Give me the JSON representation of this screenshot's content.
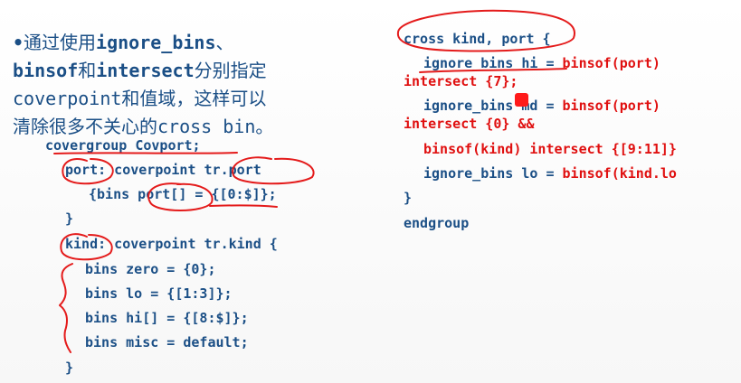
{
  "bullet": {
    "bullet_char": "•",
    "seg1": "通过使用",
    "seg2": "ignore_bins",
    "seg3": "、",
    "seg4": "binsof",
    "seg5": "和",
    "seg6": "intersect",
    "seg7": "分别指定",
    "seg8": "coverpoint",
    "seg9": "和值域，这样可以",
    "seg10": "清除很多不关心的",
    "seg11": "cross bin",
    "seg12": "。"
  },
  "left_code": {
    "l1": "covergroup Covport;",
    "l2": "port: coverpoint tr.port",
    "l3": "{bins port[] = {[0:$]};",
    "l4": "}",
    "l5": "kind: coverpoint tr.kind {",
    "l6": "bins zero = {0};",
    "l7": "bins lo = {[1:3]};",
    "l8": "bins hi[] = {[8:$]};",
    "l9": "bins misc = default;",
    "l10": "}"
  },
  "right_code": {
    "r1": "cross kind, port {",
    "r2a": "ignore_bins hi = ",
    "r2b": "binsof(port)",
    "r3": "intersect {7};",
    "r4a": "ignore_bins md = ",
    "r4b": "binsof(port)",
    "r5": "intersect {0} &&",
    "r6": "binsof(kind) intersect {[9:11]}",
    "r7a": "ignore_bins lo = ",
    "r7b": "binsof(kind.lo",
    "r8": "}",
    "r9": "endgroup"
  },
  "colors": {
    "text_blue": "#1b4f86",
    "text_red": "#e01010",
    "ink_red": "#e41b1b"
  },
  "annotations": {
    "pen_color": "#e41b1b",
    "pointer_color": "#ff1a1a"
  }
}
